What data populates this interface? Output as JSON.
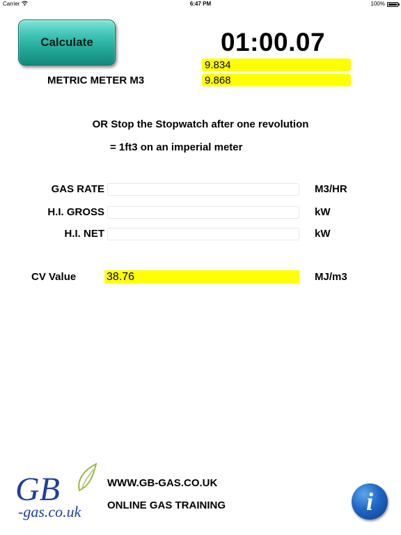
{
  "status_bar": {
    "carrier": "Carrier",
    "time": "6:47 PM",
    "battery": "100%"
  },
  "calculator": {
    "calculate_label": "Calculate",
    "timer": "01:00.07",
    "reading_1": "9.834",
    "reading_2": "9.868",
    "meter_label": "METRIC METER M3",
    "instruction_line_1": "OR Stop the Stopwatch after one revolution",
    "instruction_line_2": "= 1ft3 on an imperial meter"
  },
  "results": [
    {
      "label": "GAS RATE",
      "value": "",
      "unit": "M3/HR"
    },
    {
      "label": "H.I. GROSS",
      "value": "",
      "unit": "kW"
    },
    {
      "label": "H.I. NET",
      "value": "",
      "unit": "kW"
    }
  ],
  "cv": {
    "label": "CV Value",
    "value": "38.76",
    "unit": "MJ/m3"
  },
  "footer": {
    "logo_text_main": "GB",
    "logo_text_sub": "-gas.co.uk",
    "website": "WWW.GB-GAS.CO.UK",
    "tagline": "ONLINE GAS TRAINING",
    "info_glyph": "i"
  },
  "colors": {
    "button_teal": "#1ea393",
    "highlight_yellow": "#ffff00",
    "logo_blue": "#1f3f9c",
    "logo_flame": "#9bb84a",
    "info_blue": "#1f66c4"
  },
  "icons": [
    "wifi-icon",
    "battery-icon",
    "gb-gas-logo",
    "info-icon"
  ]
}
